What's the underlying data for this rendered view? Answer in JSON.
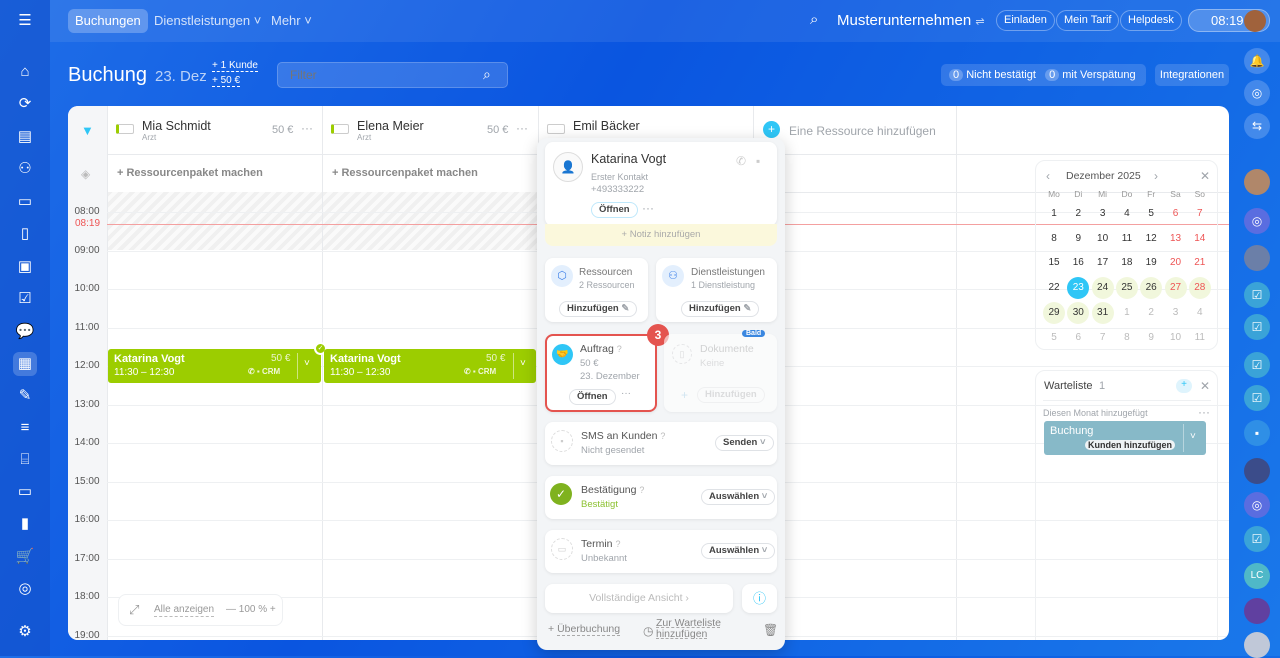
{
  "top": {
    "tabs": [
      "Buchungen",
      "Dienstleistungen",
      "Mehr"
    ],
    "company": "Musterunternehmen",
    "buttons": [
      "Einladen",
      "Mein Tarif",
      "Helpdesk"
    ],
    "time": "08:19"
  },
  "header": {
    "title": "Buchung",
    "date": "23. Dez",
    "plus_client": "+ 1 Kunde",
    "plus_amount": "+ 50 €",
    "filter_placeholder": "Filter",
    "not_confirmed_count": "0",
    "not_confirmed": "Nicht bestätigt",
    "late_count": "0",
    "late": "mit Verspätung",
    "integrations": "Integrationen"
  },
  "resources": [
    {
      "name": "Mia Schmidt",
      "role": "Arzt",
      "price": "50 €"
    },
    {
      "name": "Elena Meier",
      "role": "Arzt",
      "price": "50 €"
    },
    {
      "name": "Emil Bäcker"
    }
  ],
  "add_resource": "Eine Ressource hinzufügen",
  "package": "+ Ressourcenpaket machen",
  "hours": [
    "08:00",
    "09:00",
    "10:00",
    "11:00",
    "12:00",
    "13:00",
    "14:00",
    "15:00",
    "16:00",
    "17:00",
    "18:00",
    "19:00"
  ],
  "now": "08:19",
  "events": [
    {
      "name": "Katarina Vogt",
      "time": "11:30 – 12:30",
      "price": "50 €",
      "crm": "CRM"
    },
    {
      "name": "Katarina Vogt",
      "time": "11:30 – 12:30",
      "price": "50 €",
      "crm": "CRM"
    }
  ],
  "zoom": {
    "show_all": "Alle anzeigen",
    "level": "— 100 % +"
  },
  "popup": {
    "client": "Katarina Vogt",
    "contact": "Erster Kontakt",
    "phone": "+493333222",
    "open": "Öffnen",
    "note": "+ Notiz hinzufügen",
    "res_title": "Ressourcen",
    "res_sub": "2 Ressourcen",
    "add": "Hinzufügen",
    "svc_title": "Dienstleistungen",
    "svc_sub": "1 Dienstleistung",
    "order_title": "Auftrag",
    "order_amount": "50 €",
    "order_date": "23. Dezember",
    "badge": "3",
    "soon": "Bald",
    "doc_title": "Dokumente",
    "doc_sub": "Keine",
    "sms_title": "SMS an Kunden",
    "sms_sub": "Nicht gesendet",
    "send": "Senden",
    "conf_title": "Bestätigung",
    "conf_sub": "Bestätigt",
    "select": "Auswählen",
    "term_title": "Termin",
    "term_sub": "Unbekannt",
    "full_view": "Vollständige Ansicht ›",
    "overbooking": "Überbuchung",
    "waitlist_add": "Zur Warteliste hinzufügen"
  },
  "calendar": {
    "month": "Dezember 2025",
    "weekdays": [
      "Mo",
      "Di",
      "Mi",
      "Do",
      "Fr",
      "Sa",
      "So"
    ],
    "days": [
      "1",
      "2",
      "3",
      "4",
      "5",
      "6",
      "7",
      "8",
      "9",
      "10",
      "11",
      "12",
      "13",
      "14",
      "15",
      "16",
      "17",
      "18",
      "19",
      "20",
      "21",
      "22",
      "23",
      "24",
      "25",
      "26",
      "27",
      "28",
      "29",
      "30",
      "31",
      "1",
      "2",
      "3",
      "4",
      "5",
      "6",
      "7",
      "8",
      "9",
      "10",
      "11"
    ]
  },
  "waitlist": {
    "title": "Warteliste",
    "count": "1",
    "group": "Diesen Monat hinzugefügt",
    "item": "Buchung",
    "add_client": "Kunden hinzufügen"
  }
}
